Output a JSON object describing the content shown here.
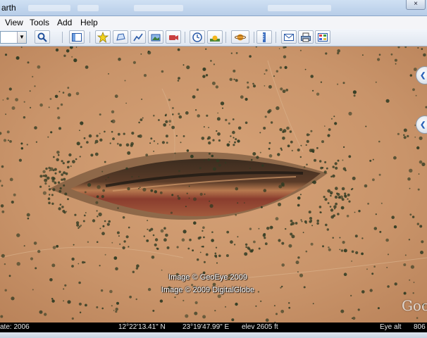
{
  "window": {
    "title": "arth",
    "close_glyph": "×"
  },
  "menu": [
    "View",
    "Tools",
    "Add",
    "Help"
  ],
  "toolbar": {
    "search_dropdown_glyph": "▼",
    "icons": [
      "search-icon",
      "sidebar-icon",
      "placemark-icon",
      "polygon-icon",
      "path-icon",
      "image-overlay-icon",
      "record-tour-icon",
      "historical-imagery-icon",
      "sunlight-icon",
      "planets-icon",
      "ruler-icon",
      "email-icon",
      "print-icon",
      "save-image-icon"
    ]
  },
  "map": {
    "credit_line1": "Image © GeoEye 2009",
    "credit_line2": "Image © 2009 DigitalGlobe",
    "logo_text": "Goo",
    "nav_glyph": "❮"
  },
  "status": {
    "date": "ate: 2006",
    "latitude": "12°22'13.41\" N",
    "longitude": "23°19'47.99\" E",
    "elevation": "elev  2605 ft",
    "eye_alt_label": "Eye alt",
    "eye_alt_value": "806"
  },
  "colors": {
    "ground": "#c9946a",
    "shrub": "#2f3a22",
    "crater_dark": "#4a3524",
    "crater_red": "#8a3d2e"
  }
}
